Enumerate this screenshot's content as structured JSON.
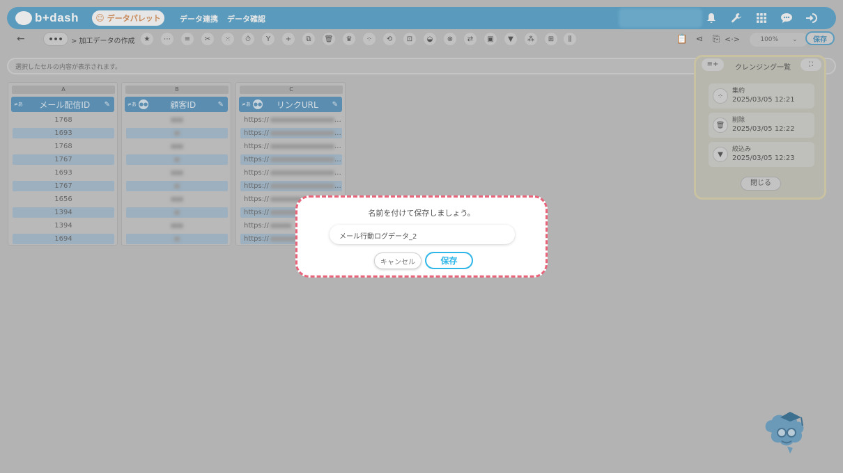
{
  "app": {
    "logo_text": "b+dash",
    "palette_label": "データパレット",
    "nav": [
      "データ連携",
      "データ確認"
    ]
  },
  "topbar_icons": [
    "bell-icon",
    "wrench-icon",
    "grid-icon",
    "chat-icon",
    "logout-icon"
  ],
  "toolbar": {
    "back_label": "←",
    "more_label": "•••",
    "breadcrumb": "> 加工データの作成",
    "zoom": "100%",
    "save_label": "保存"
  },
  "cell_preview_placeholder": "選択したセルの内容が表示されます。",
  "columns": [
    {
      "letter": "A",
      "title": "メール配信ID",
      "values": [
        "1768",
        "1693",
        "1768",
        "1767",
        "1693",
        "1767",
        "1656",
        "1394",
        "1394",
        "1694"
      ]
    },
    {
      "letter": "B",
      "title": "顧客ID",
      "values": []
    },
    {
      "letter": "C",
      "title": "リンクURL",
      "values": [
        "https://",
        "https://",
        "https://",
        "https://",
        "https://",
        "https://",
        "https://",
        "https://",
        "https://",
        "https://"
      ]
    }
  ],
  "panel": {
    "title": "クレンジング一覧",
    "history": [
      {
        "name": "集約",
        "time": "2025/03/05 12:21",
        "icon": "aggregate-icon"
      },
      {
        "name": "削除",
        "time": "2025/03/05 12:22",
        "icon": "trash-icon"
      },
      {
        "name": "絞込み",
        "time": "2025/03/05 12:23",
        "icon": "filter-icon"
      }
    ],
    "close_label": "閉じる"
  },
  "modal": {
    "title": "名前を付けて保存しましょう。",
    "input_value": "メール行動ログデータ_2",
    "cancel_label": "キャンセル",
    "save_label": "保存"
  },
  "colors": {
    "brand": "#5a9bbd",
    "modal_border": "#e8647a",
    "save_accent": "#2fb6e8"
  }
}
